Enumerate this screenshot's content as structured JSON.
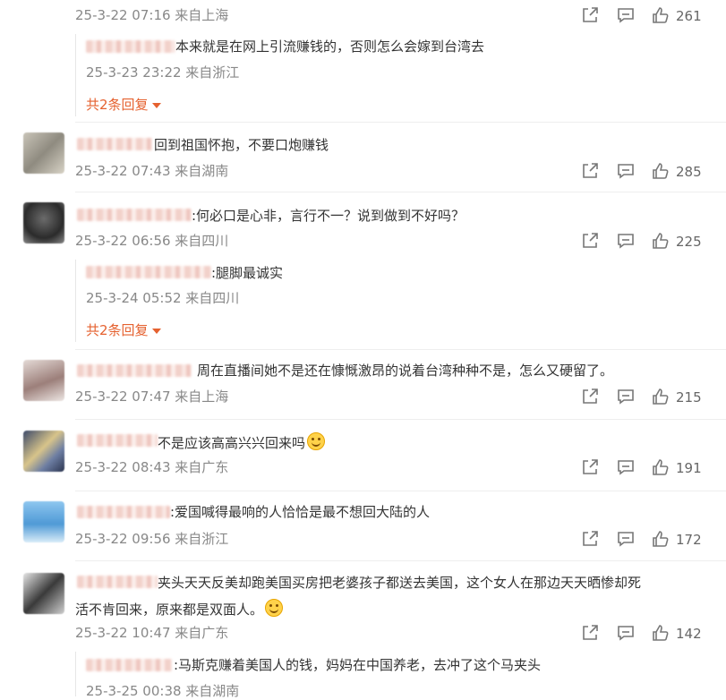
{
  "comments": [
    {
      "id": "c1",
      "text": "",
      "meta": "25-3-22 07:16 来自上海",
      "likes": "261",
      "replies": [
        {
          "text": "本来就是在网上引流赚钱的，否则怎么会嫁到台湾去",
          "meta": "25-3-23 23:22 来自浙江"
        }
      ],
      "more_replies": "共2条回复"
    },
    {
      "id": "c2",
      "text": "回到祖国怀抱，不要口炮赚钱",
      "meta": "25-3-22 07:43 来自湖南",
      "likes": "285"
    },
    {
      "id": "c3",
      "text": ":何必口是心非，言行不一？说到做到不好吗？",
      "meta": "25-3-22 06:56 来自四川",
      "likes": "225",
      "replies": [
        {
          "text": ":腿脚最诚实",
          "meta": "25-3-24 05:52 来自四川"
        }
      ],
      "more_replies": "共2条回复"
    },
    {
      "id": "c4",
      "text": "周在直播间她不是还在慷慨激昂的说着台湾种种不是，怎么又硬留了。",
      "meta": "25-3-22 07:47 来自上海",
      "likes": "215"
    },
    {
      "id": "c5",
      "text": "不是应该高高兴兴回来吗",
      "meta": "25-3-22 08:43 来自广东",
      "likes": "191"
    },
    {
      "id": "c6",
      "text": ":爱国喊得最响的人恰恰是最不想回大陆的人",
      "meta": "25-3-22 09:56 来自浙江",
      "likes": "172"
    },
    {
      "id": "c7",
      "text_line1": "夹头天天反美却跑美国买房把老婆孩子都送去美国，这个女人在那边天天晒惨却死",
      "text_line2": "活不肯回来，原来都是双面人。",
      "meta": "25-3-22 10:47 来自广东",
      "likes": "142",
      "replies": [
        {
          "text": ":马斯克赚着美国人的钱，妈妈在中国养老，去冲了这个马夹头",
          "meta": "25-3-25 00:38 来自湖南"
        }
      ]
    }
  ],
  "icons": {
    "share": "share-icon",
    "reply": "comment-icon",
    "like": "thumbs-up-icon"
  },
  "colors": {
    "accent": "#e5612f",
    "meta": "#888888",
    "text": "#333333"
  }
}
